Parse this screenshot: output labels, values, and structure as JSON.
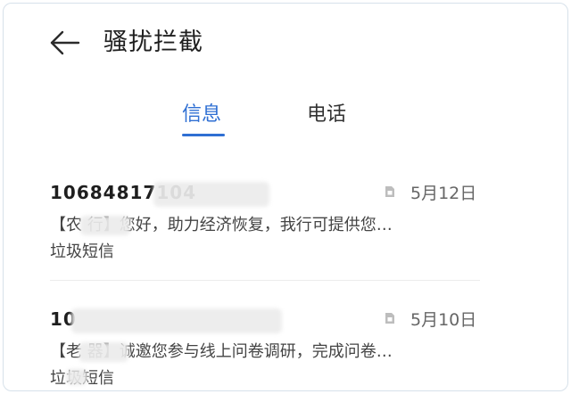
{
  "header": {
    "title": "骚扰拦截",
    "back_icon": "back-arrow-icon"
  },
  "tabs": [
    {
      "label": "信息",
      "active": true
    },
    {
      "label": "电话",
      "active": false
    }
  ],
  "colors": {
    "accent": "#2f6fd3",
    "text_primary": "#1e1e1e",
    "text_secondary": "#444444",
    "date": "#666666"
  },
  "messages": [
    {
      "sender": "10684817104",
      "sim_icon": "sim-card-icon",
      "date": "5月12日",
      "preview": "【农     行】您好，助力经济恢复，我行可提供您…",
      "category": "垃圾短信"
    },
    {
      "sender": "10",
      "sim_icon": "sim-card-icon",
      "date": "5月10日",
      "preview": "【老     器】诚邀您参与线上问卷调研，完成问卷…",
      "category": "垃圾短信"
    }
  ]
}
